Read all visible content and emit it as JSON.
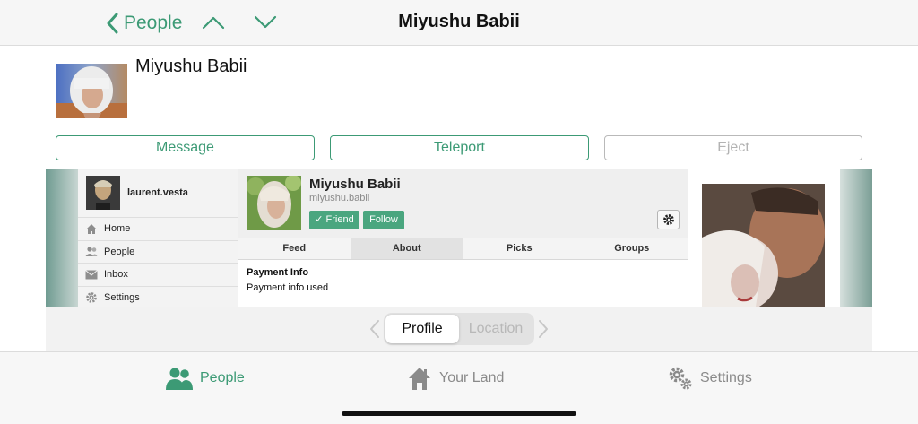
{
  "nav": {
    "back_label": "People",
    "title": "Miyushu Babii"
  },
  "profile": {
    "name": "Miyushu Babii"
  },
  "actions": {
    "message": "Message",
    "teleport": "Teleport",
    "eject": "Eject"
  },
  "web": {
    "sidebar": {
      "user": "laurent.vesta",
      "items": [
        "Home",
        "People",
        "Inbox",
        "Settings"
      ]
    },
    "profile": {
      "name": "Miyushu Babii",
      "handle": "miyushu.babii",
      "friend_button": "✓ Friend",
      "follow_button": "Follow"
    },
    "tabs": [
      "Feed",
      "About",
      "Picks",
      "Groups"
    ],
    "active_tab": "About",
    "section_title": "Payment Info",
    "section_text": "Payment info used"
  },
  "segments": {
    "profile": "Profile",
    "location": "Location",
    "selected": "Profile"
  },
  "tabbar": {
    "people": "People",
    "your_land": "Your Land",
    "settings": "Settings"
  },
  "colors": {
    "accent": "#3c9a75",
    "web_button": "#4aa67f"
  }
}
